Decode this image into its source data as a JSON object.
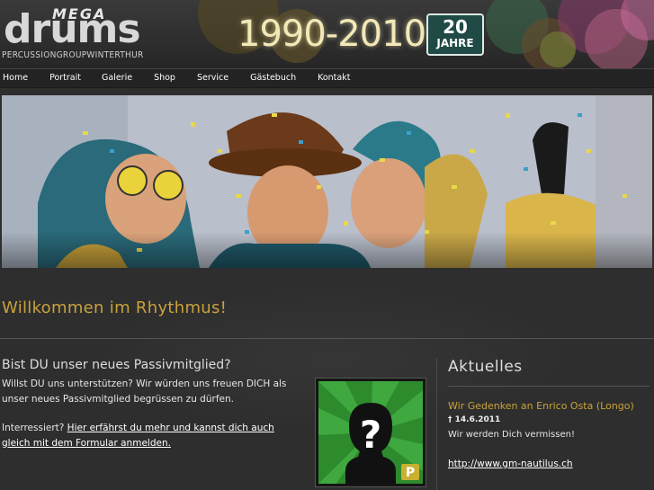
{
  "header": {
    "logo_mega": "MEGA",
    "logo_drums": "drums",
    "logo_sub": "PERCUSSIONGROUPWINTERTHUR",
    "years": "1990-2010",
    "badge_number": "20",
    "badge_text": "JAHRE"
  },
  "nav": {
    "items": [
      {
        "label": "Home"
      },
      {
        "label": "Portrait"
      },
      {
        "label": "Galerie"
      },
      {
        "label": "Shop"
      },
      {
        "label": "Service"
      },
      {
        "label": "Gästebuch"
      },
      {
        "label": "Kontakt"
      }
    ]
  },
  "main": {
    "welcome": "Willkommen im Rhythmus!",
    "passiv": {
      "heading": "Bist DU unser neues Passivmitglied?",
      "line1": "Willst DU uns unterstützen? Wir würden uns freuen DICH als unser neues Passivmitglied begrüssen zu dürfen.",
      "line2_prefix": "Interressiert? ",
      "link_text": "Hier erfährst du mehr und kannst dich auch gleich mit dem Formular anmelden.",
      "badge_letter": "P",
      "question_mark": "?"
    },
    "aktuelles": {
      "heading": "Aktuelles",
      "news_title": "Wir Gedenken an Enrico Osta (Longo)",
      "news_date": "† 14.6.2011",
      "news_text": "Wir werden Dich vermissen!",
      "news_link": "http://www.gm-nautilus.ch"
    }
  },
  "colors": {
    "accent_gold": "#c9a23a",
    "background": "#2e2e2e",
    "badge_green": "#1f4a45"
  }
}
